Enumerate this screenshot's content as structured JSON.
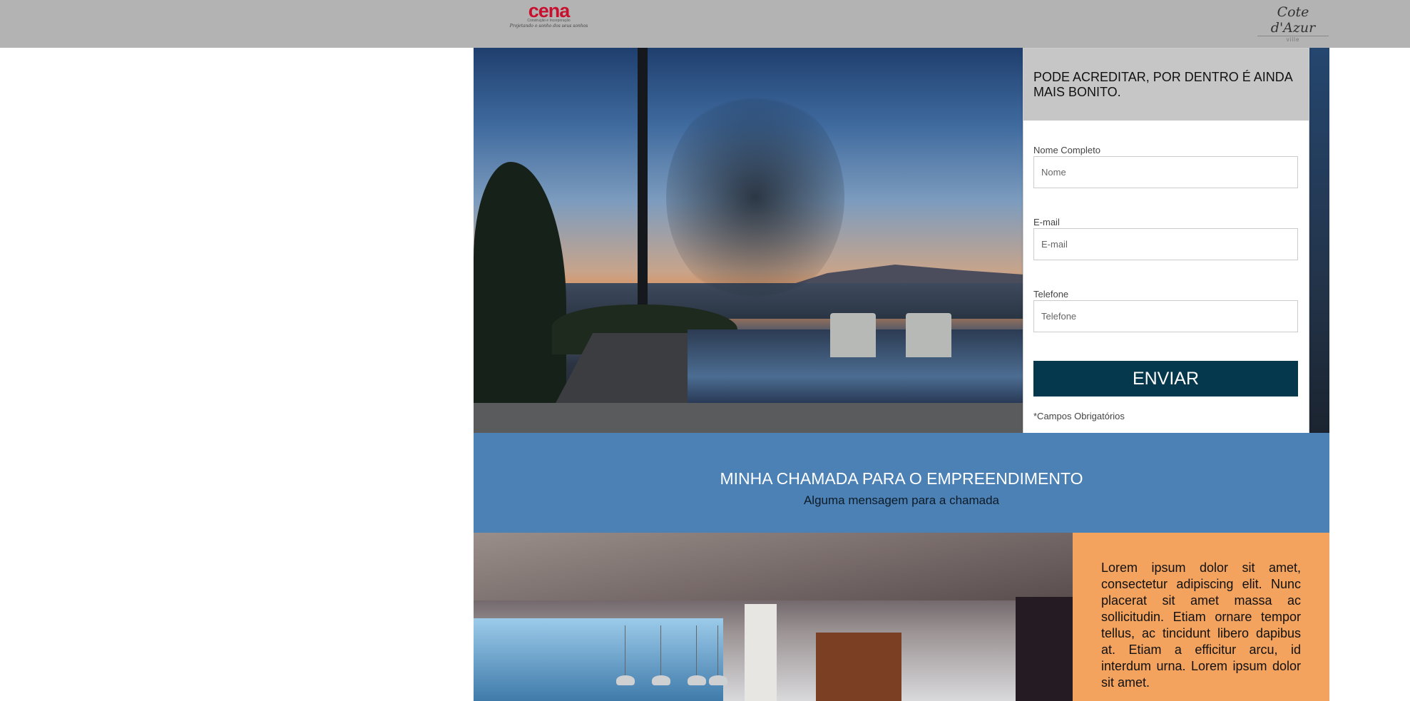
{
  "header": {
    "logo_left": {
      "brand": "cena",
      "subtitle": "Construção e Incorporação",
      "tagline": "Projetando o sonho dos seus sonhos"
    },
    "logo_right": {
      "script": "Cote d'Azur",
      "sub": "ville"
    },
    "background": "#b3b3b3"
  },
  "hero": {
    "image": "sunset-pool-photo"
  },
  "form": {
    "title": "PODE ACREDITAR, POR DENTRO É AINDA MAIS BONITO.",
    "fields": [
      {
        "label": "Nome Completo",
        "placeholder": "Nome",
        "value": ""
      },
      {
        "label": "E-mail",
        "placeholder": "E-mail",
        "value": ""
      },
      {
        "label": "Telefone",
        "placeholder": "Telefone",
        "value": ""
      }
    ],
    "submit_label": "ENVIAR",
    "required_note": "*Campos Obrigatórios",
    "button_color": "#05384d"
  },
  "callout": {
    "title": "MINHA CHAMADA PARA O EMPREENDIMENTO",
    "subtitle": "Alguma mensagem para a chamada",
    "background": "#4b81b5"
  },
  "feature": {
    "image": "interior-lounge-photo",
    "text": "Lorem ipsum dolor sit amet, consectetur adipiscing elit. Nunc placerat sit amet massa ac sollicitudin. Etiam ornare tempor tellus, ac tincidunt libero dapibus at. Etiam a efficitur arcu, id interdum urna. Lorem ipsum dolor sit amet.",
    "background": "#f3a35e"
  }
}
